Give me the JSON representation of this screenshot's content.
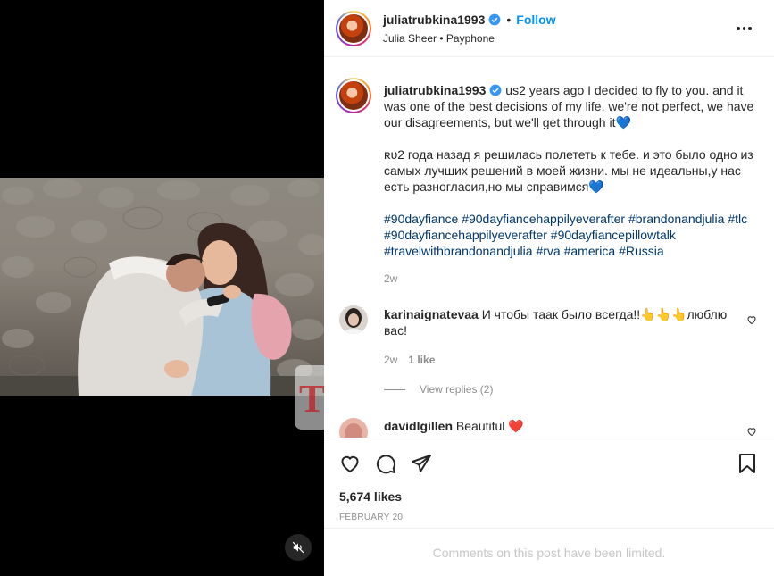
{
  "post": {
    "username": "juliatrubkina1993",
    "follow_label": "Follow",
    "separator": "•",
    "audio": "Julia Sheer • Payphone"
  },
  "caption": {
    "username": "juliatrubkina1993",
    "text_en": "us2 years ago I decided to fly to you. and it was one of the best decisions of my life. we're not perfect, we have our disagreements, but we'll get through it💙",
    "text_ru": "ʀᴜ2 года назад я решилась полететь к тебе. и это было одно из самых лучших решений в моей жизни. мы не идеальны,у нас есть разногласия,но мы справимся💙",
    "hashtags": [
      "#90dayfiance",
      "#90dayfiancehappilyeverafter",
      "#brandonandjulia",
      "#tlc",
      "#90dayfiancehappilyeverafter",
      "#90dayfiancepillowtalk",
      "#travelwithbrandonandjulia",
      "#rva",
      "#america",
      "#Russia"
    ],
    "time": "2w"
  },
  "comments": [
    {
      "username": "karinaignatevaa",
      "text": "И чтобы таак было всегда!!👆👆👆люблю вас!",
      "time": "2w",
      "likes": "1 like",
      "view_replies": "View replies (2)"
    },
    {
      "username": "davidlgillen",
      "text": "Beautiful ❤️"
    }
  ],
  "stats": {
    "likes": "5,674 likes",
    "date": "FEBRUARY 20"
  },
  "footer": {
    "limited_text": "Comments on this post have been limited."
  },
  "watermark": {
    "text": "TV"
  },
  "icons": {
    "verified": "verified-badge-icon",
    "more": "more-options-icon",
    "like": "heart-icon",
    "comment": "comment-icon",
    "share": "share-icon",
    "save": "bookmark-icon",
    "mute": "mute-icon"
  },
  "colors": {
    "accent": "#0095f6",
    "hashtag": "#00376b",
    "muted": "#8e8e8e",
    "heart": "#ed4956"
  }
}
